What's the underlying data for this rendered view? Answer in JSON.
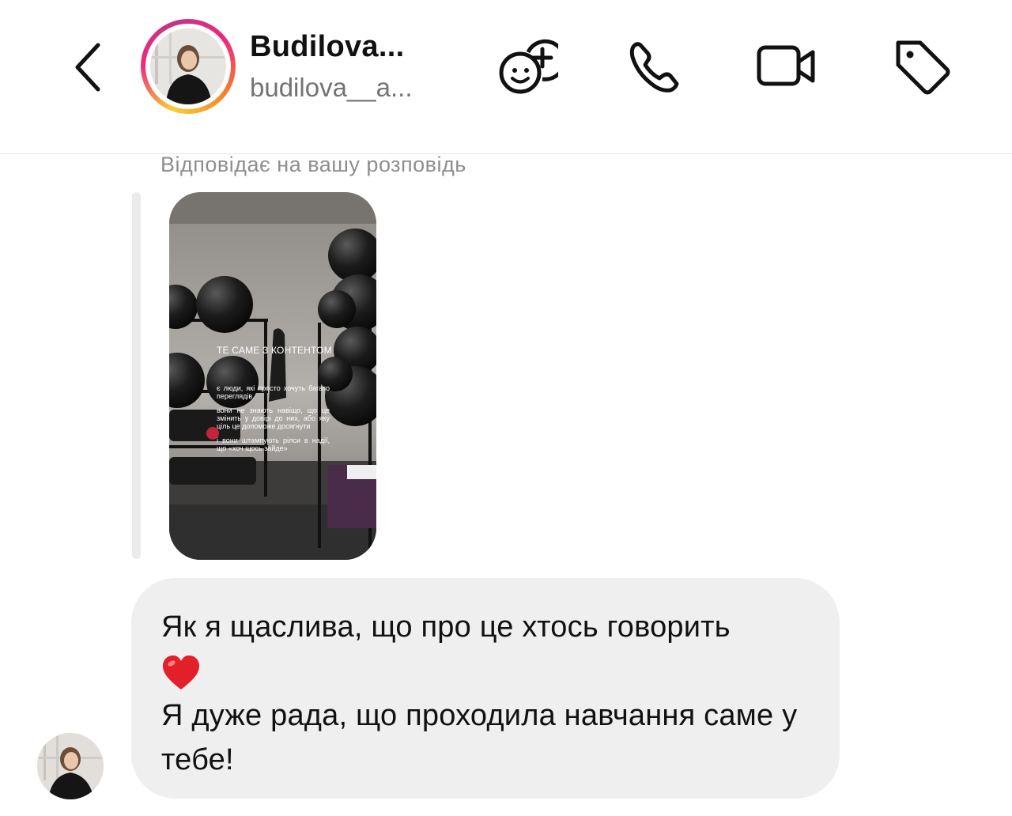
{
  "header": {
    "back_icon": "chevron-left-icon",
    "display_name": "Budilova...",
    "username": "budilova__a...",
    "actions": [
      {
        "icon": "add-friend-sticker-icon"
      },
      {
        "icon": "phone-icon"
      },
      {
        "icon": "video-camera-icon"
      },
      {
        "icon": "tag-icon"
      }
    ],
    "ring_colors": [
      "#f9ce34",
      "#ee2a7b",
      "#c13584",
      "#f58529"
    ]
  },
  "conversation": {
    "reply_caption": "Відповідає на вашу розповідь",
    "story": {
      "title": "ТЕ САМЕ З КОНТЕНТОМ",
      "lines": [
        "є люди, які просто хочуть багато переглядів",
        "вони не знають навіщо, що це змінить у довірі до них, або яку ціль це допоможе досягнути",
        "і вони штампують рілси в надії, що «хоч щось зайде»"
      ]
    },
    "message": {
      "line1": "Як я щаслива, що про це хтось говорить",
      "emoji": "❤️",
      "line2": "Я дуже рада, що проходила навчання саме у тебе!"
    }
  }
}
